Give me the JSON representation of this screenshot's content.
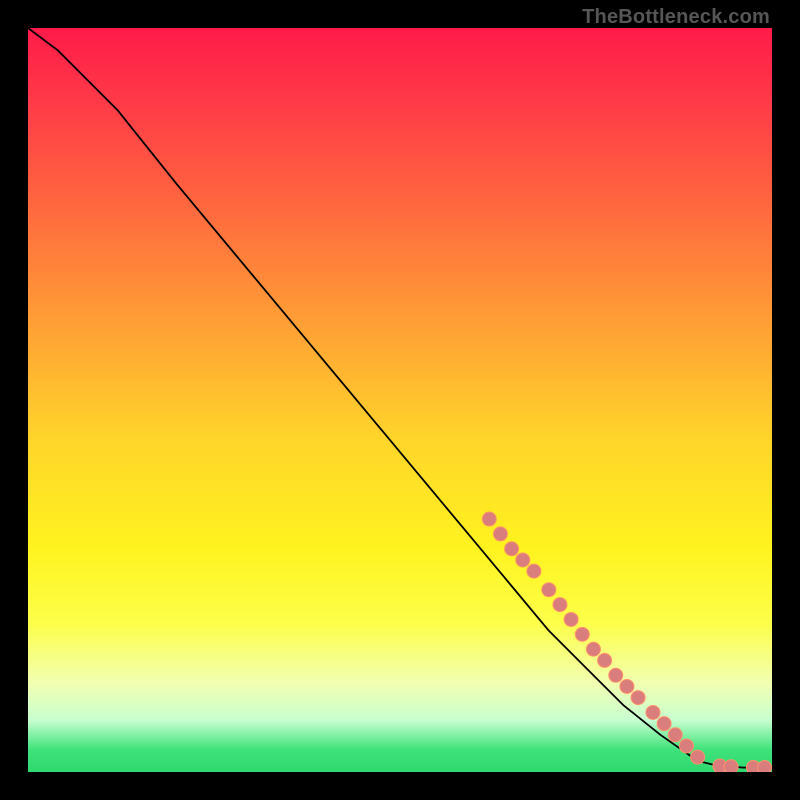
{
  "attribution": "TheBottleneck.com",
  "colors": {
    "marker_fill": "#d97d7d",
    "marker_stroke": "#ff926a",
    "curve": "#000000"
  },
  "chart_data": {
    "type": "line",
    "title": "",
    "xlabel": "",
    "ylabel": "",
    "xlim": [
      0,
      100
    ],
    "ylim": [
      0,
      100
    ],
    "curve": {
      "x": [
        0,
        4,
        8,
        12,
        16,
        20,
        30,
        40,
        50,
        60,
        65,
        70,
        75,
        80,
        85,
        90,
        92,
        94,
        96,
        98,
        100
      ],
      "y": [
        100,
        97,
        93,
        89,
        84,
        79,
        67,
        55,
        43,
        31,
        25,
        19,
        14,
        9,
        5,
        1.5,
        1.0,
        0.8,
        0.6,
        0.6,
        0.6
      ]
    },
    "markers": [
      {
        "x": 62,
        "y": 34
      },
      {
        "x": 63.5,
        "y": 32
      },
      {
        "x": 65,
        "y": 30
      },
      {
        "x": 66.5,
        "y": 28.5
      },
      {
        "x": 68,
        "y": 27
      },
      {
        "x": 70,
        "y": 24.5
      },
      {
        "x": 71.5,
        "y": 22.5
      },
      {
        "x": 73,
        "y": 20.5
      },
      {
        "x": 74.5,
        "y": 18.5
      },
      {
        "x": 76,
        "y": 16.5
      },
      {
        "x": 77.5,
        "y": 15
      },
      {
        "x": 79,
        "y": 13
      },
      {
        "x": 80.5,
        "y": 11.5
      },
      {
        "x": 82,
        "y": 10
      },
      {
        "x": 84,
        "y": 8
      },
      {
        "x": 85.5,
        "y": 6.5
      },
      {
        "x": 87,
        "y": 5
      },
      {
        "x": 88.5,
        "y": 3.5
      },
      {
        "x": 90,
        "y": 2
      },
      {
        "x": 93,
        "y": 0.8
      },
      {
        "x": 94.5,
        "y": 0.7
      },
      {
        "x": 97.5,
        "y": 0.6
      },
      {
        "x": 99,
        "y": 0.6
      }
    ],
    "marker_radius": 7
  }
}
